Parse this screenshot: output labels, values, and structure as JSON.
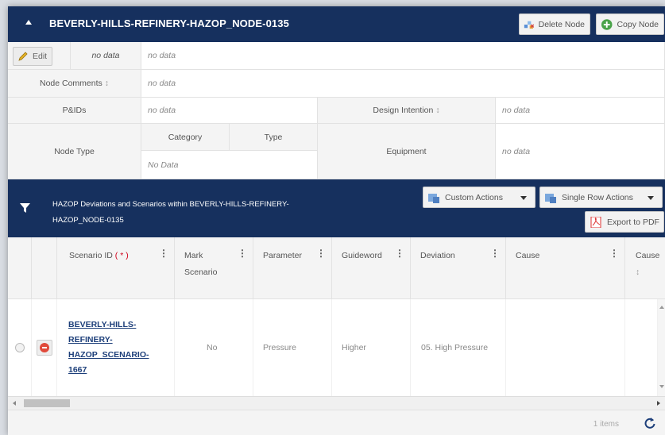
{
  "node": {
    "title": "BEVERLY-HILLS-REFINERY-HAZOP_NODE-0135",
    "delete_label": "Delete Node",
    "copy_label": "Copy Node"
  },
  "props": {
    "edit_label": "Edit",
    "edit_row_value": "no data",
    "edit_row_value2": "no data",
    "node_comments_label": "Node Comments",
    "node_comments_value": "no data",
    "pids_label": "P&IDs",
    "pids_value": "no data",
    "design_intention_label": "Design Intention",
    "design_intention_value": "no data",
    "node_type_label": "Node Type",
    "category_label": "Category",
    "type_label": "Type",
    "node_type_value": "No Data",
    "equipment_label": "Equipment",
    "equipment_value": "no data"
  },
  "deviations": {
    "title": "HAZOP Deviations and Scenarios within BEVERLY-HILLS-REFINERY-HAZOP_NODE-0135",
    "custom_actions": "Custom Actions",
    "single_row_actions": "Single Row Actions",
    "export_pdf": "Export to PDF"
  },
  "grid": {
    "columns": [
      "Scenario ID",
      "Mark Scenario",
      "Parameter",
      "Guideword",
      "Deviation",
      "Cause",
      "Cause"
    ],
    "required_marker": "( * )",
    "rows": [
      {
        "scenario_id": "BEVERLY-HILLS-REFINERY-HAZOP_SCENARIO-1667",
        "mark": "No",
        "parameter": "Pressure",
        "guideword": "Higher",
        "deviation": "05. High Pressure",
        "cause": ""
      }
    ],
    "item_count": "1 items"
  },
  "colors": {
    "header_bg": "#16305e",
    "link": "#1d3f7a",
    "required": "#d0021b"
  }
}
